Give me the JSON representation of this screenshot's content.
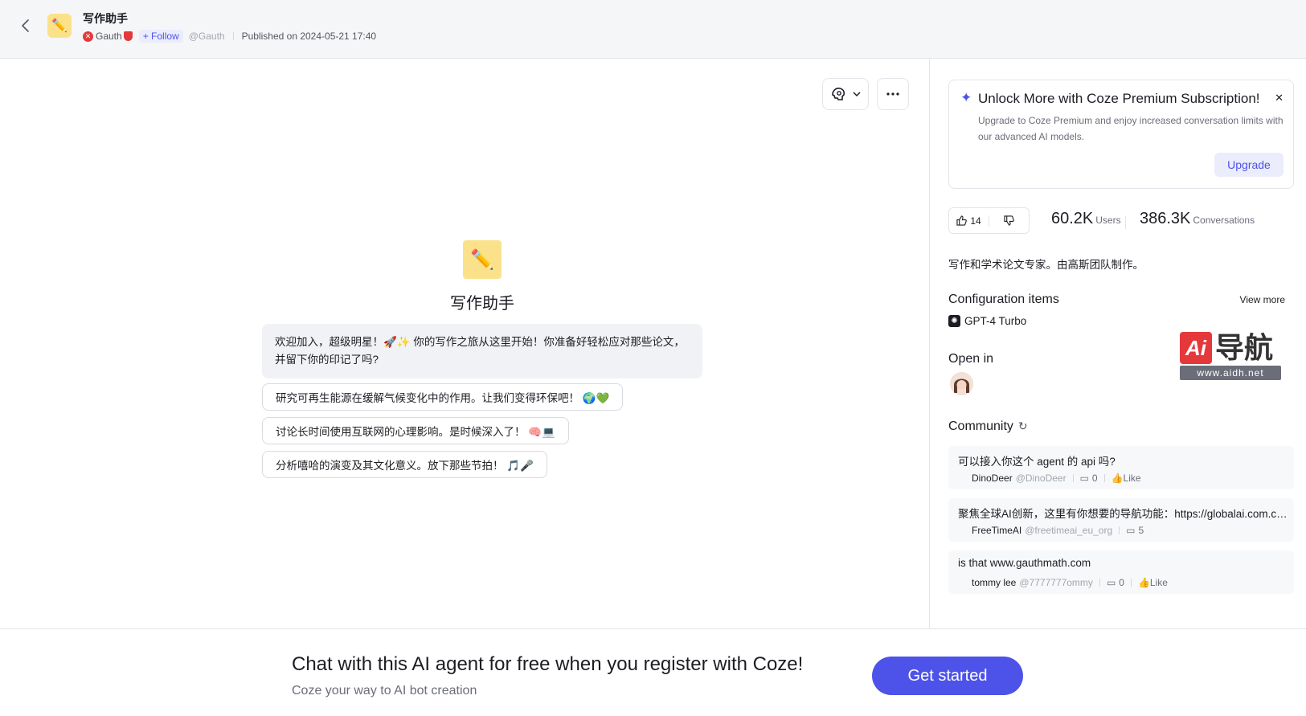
{
  "header": {
    "bot_name": "写作助手",
    "author": "Gauth",
    "follow_label": "+ Follow",
    "handle": "@Gauth",
    "published": "Published on 2024-05-21 17:40"
  },
  "chat": {
    "bot_name": "写作助手",
    "welcome": "欢迎加入，超级明星！🚀✨ 你的写作之旅从这里开始！你准备好轻松应对那些论文，并留下你的印记了吗?",
    "suggestions": [
      "研究可再生能源在缓解气候变化中的作用。让我们变得环保吧！ 🌍💚",
      "讨论长时间使用互联网的心理影响。是时候深入了！ 🧠💻",
      "分析嘻哈的演变及其文化意义。放下那些节拍！ 🎵🎤"
    ]
  },
  "promo": {
    "title": "Unlock More with Coze Premium Subscription!",
    "text": "Upgrade to Coze Premium and enjoy increased conversation limits with our advanced AI models.",
    "button": "Upgrade"
  },
  "stats": {
    "likes": "14",
    "users_num": "60.2K",
    "users_label": "Users",
    "conv_num": "386.3K",
    "conv_label": "Conversations"
  },
  "description": "写作和学术论文专家。由高斯团队制作。",
  "config": {
    "title": "Configuration items",
    "view_more": "View more",
    "model": "GPT-4 Turbo"
  },
  "open_in": {
    "title": "Open in"
  },
  "watermark": {
    "cn": "导航",
    "ai": "Ai",
    "url": "www.aidh.net"
  },
  "community": {
    "title": "Community",
    "posts": [
      {
        "text": "可以接入你这个 agent 的 api 吗?",
        "user": "DinoDeer",
        "handle": "@DinoDeer",
        "comments": "0",
        "like": "👍Like"
      },
      {
        "text": "聚焦全球AI创新，这里有你想要的导航功能：https://globalai.com.cn/ai-tools",
        "user": "FreeTimeAI",
        "handle": "@freetimeai_eu_org",
        "comments": "5",
        "like": ""
      },
      {
        "text": "is that www.gauthmath.com",
        "user": "tommy lee",
        "handle": "@7777777ommy",
        "comments": "0",
        "like": "👍Like"
      }
    ]
  },
  "bottom": {
    "title": "Chat with this AI agent for free when you register with Coze!",
    "subtitle": "Coze your way to AI bot creation",
    "button": "Get started"
  }
}
